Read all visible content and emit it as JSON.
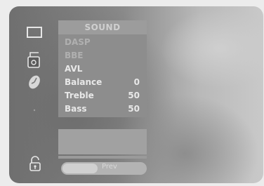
{
  "sidebar": {
    "icons": [
      "screen-icon",
      "sound-icon",
      "clock-icon",
      "dot-icon",
      "lock-icon"
    ]
  },
  "menu": {
    "title": "SOUND",
    "items": [
      {
        "label": "DASP",
        "value": ""
      },
      {
        "label": "BBE",
        "value": ""
      },
      {
        "label": "AVL",
        "value": ""
      },
      {
        "label": "Balance",
        "value": "0"
      },
      {
        "label": "Treble",
        "value": "50"
      },
      {
        "label": "Bass",
        "value": "50"
      }
    ]
  },
  "toggle": {
    "label": "Prev"
  }
}
